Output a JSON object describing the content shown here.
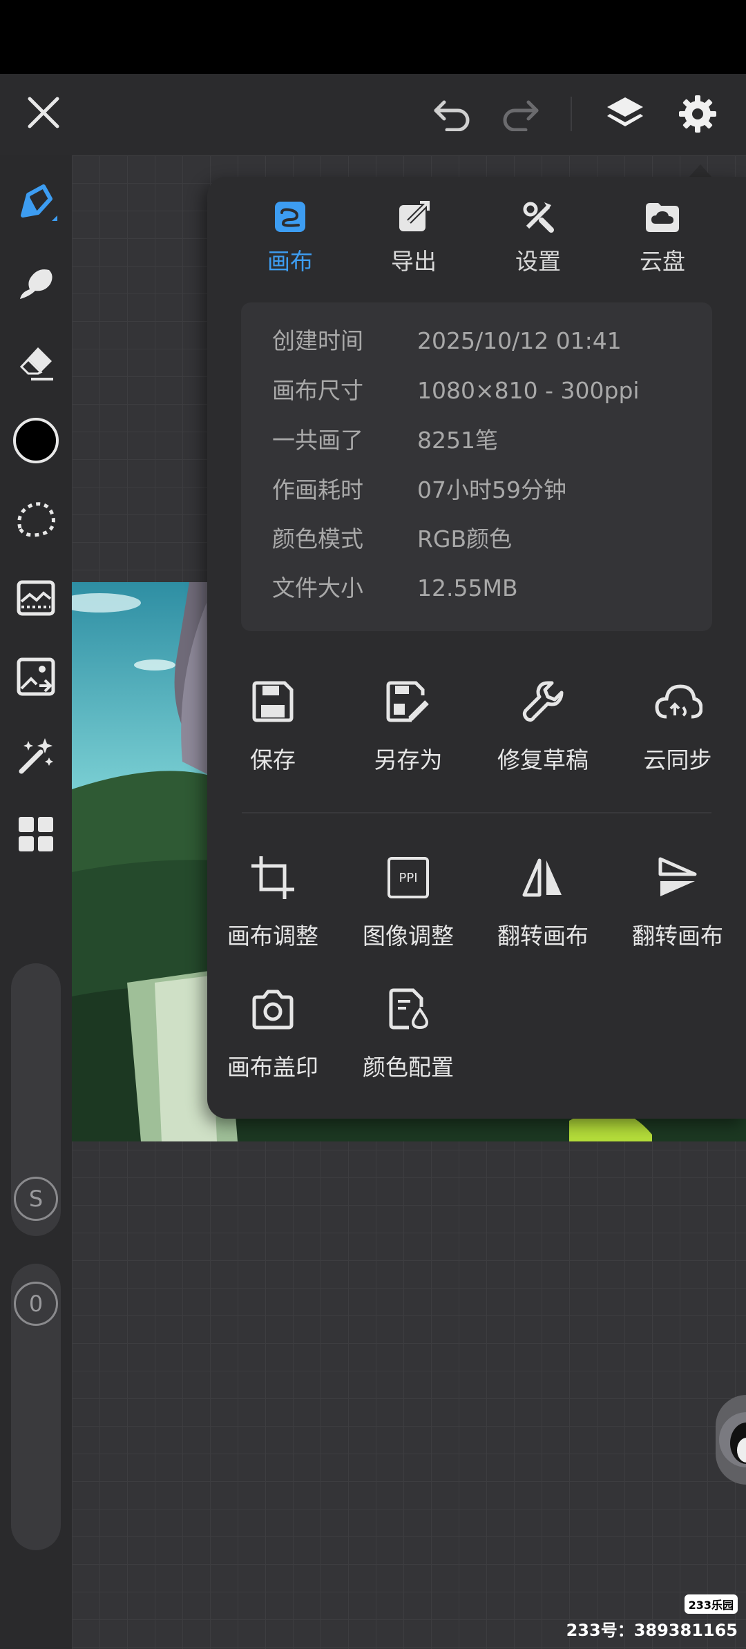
{
  "top_bar": {
    "icons": [
      "close-icon",
      "undo-icon",
      "redo-icon",
      "layers-icon",
      "settings-icon"
    ]
  },
  "tools": [
    "brush-icon",
    "smudge-icon",
    "eraser-icon",
    "color-swatch",
    "lasso-icon",
    "filter-icon",
    "import-image-icon",
    "magic-wand-icon",
    "grid-menu-icon"
  ],
  "colors": {
    "accent": "#3d9df2",
    "panel_bg": "#2c2c2e",
    "info_bg": "#343437",
    "current_color": "#000000"
  },
  "sliders": {
    "size_label": "S",
    "opacity_label": "0"
  },
  "panel": {
    "tabs": [
      {
        "label": "画布",
        "icon": "canvas-icon",
        "active": true
      },
      {
        "label": "导出",
        "icon": "export-icon",
        "active": false
      },
      {
        "label": "设置",
        "icon": "tools-icon",
        "active": false
      },
      {
        "label": "云盘",
        "icon": "cloud-drive-icon",
        "active": false
      }
    ],
    "info": [
      {
        "key": "创建时间",
        "value": "2025/10/12 01:41"
      },
      {
        "key": "画布尺寸",
        "value": "1080×810 - 300ppi"
      },
      {
        "key": "一共画了",
        "value": "8251笔"
      },
      {
        "key": "作画耗时",
        "value": "07小时59分钟"
      },
      {
        "key": "颜色模式",
        "value": "RGB颜色"
      },
      {
        "key": "文件大小",
        "value": "12.55MB"
      }
    ],
    "actions_row1": [
      {
        "label": "保存",
        "icon": "save-icon"
      },
      {
        "label": "另存为",
        "icon": "save-as-icon"
      },
      {
        "label": "修复草稿",
        "icon": "wrench-icon"
      },
      {
        "label": "云同步",
        "icon": "cloud-sync-icon"
      }
    ],
    "actions_row2": [
      {
        "label": "画布调整",
        "icon": "crop-icon"
      },
      {
        "label": "图像调整",
        "icon": "ppi-icon",
        "icon_text": "PPI"
      },
      {
        "label": "翻转画布",
        "icon": "flip-horizontal-icon"
      },
      {
        "label": "翻转画布",
        "icon": "flip-vertical-icon"
      }
    ],
    "actions_row3": [
      {
        "label": "画布盖印",
        "icon": "camera-icon"
      },
      {
        "label": "颜色配置",
        "icon": "color-config-icon"
      }
    ]
  },
  "watermark": {
    "logo": "233乐园",
    "id_text": "233号：389381165"
  }
}
